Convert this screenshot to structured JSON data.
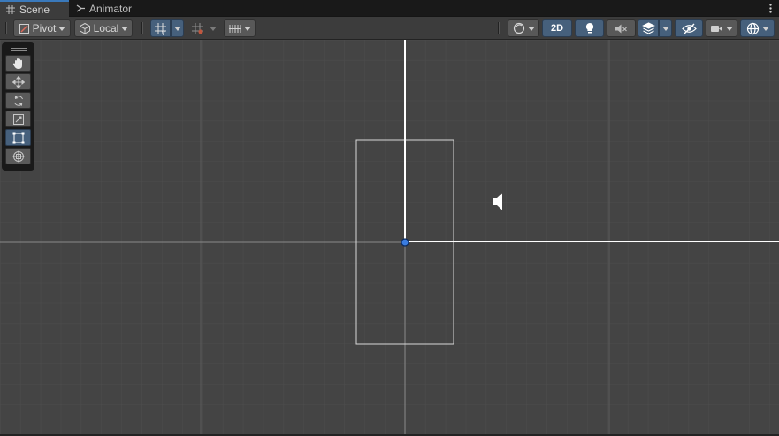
{
  "tabs": {
    "scene": "Scene",
    "animator": "Animator"
  },
  "toolbar": {
    "pivot_label": "Pivot",
    "space_label": "Local",
    "mode_2d_label": "2D"
  },
  "tools": [
    "hand-tool",
    "move-tool",
    "rotate-tool",
    "scale-tool",
    "rect-tool",
    "transform-tool"
  ],
  "active_tool": "rect-tool",
  "colors": {
    "accent": "#3a79bb",
    "active_button": "#46607c",
    "viewport_bg": "#444444",
    "gizmo_origin": "#3b7de0"
  }
}
